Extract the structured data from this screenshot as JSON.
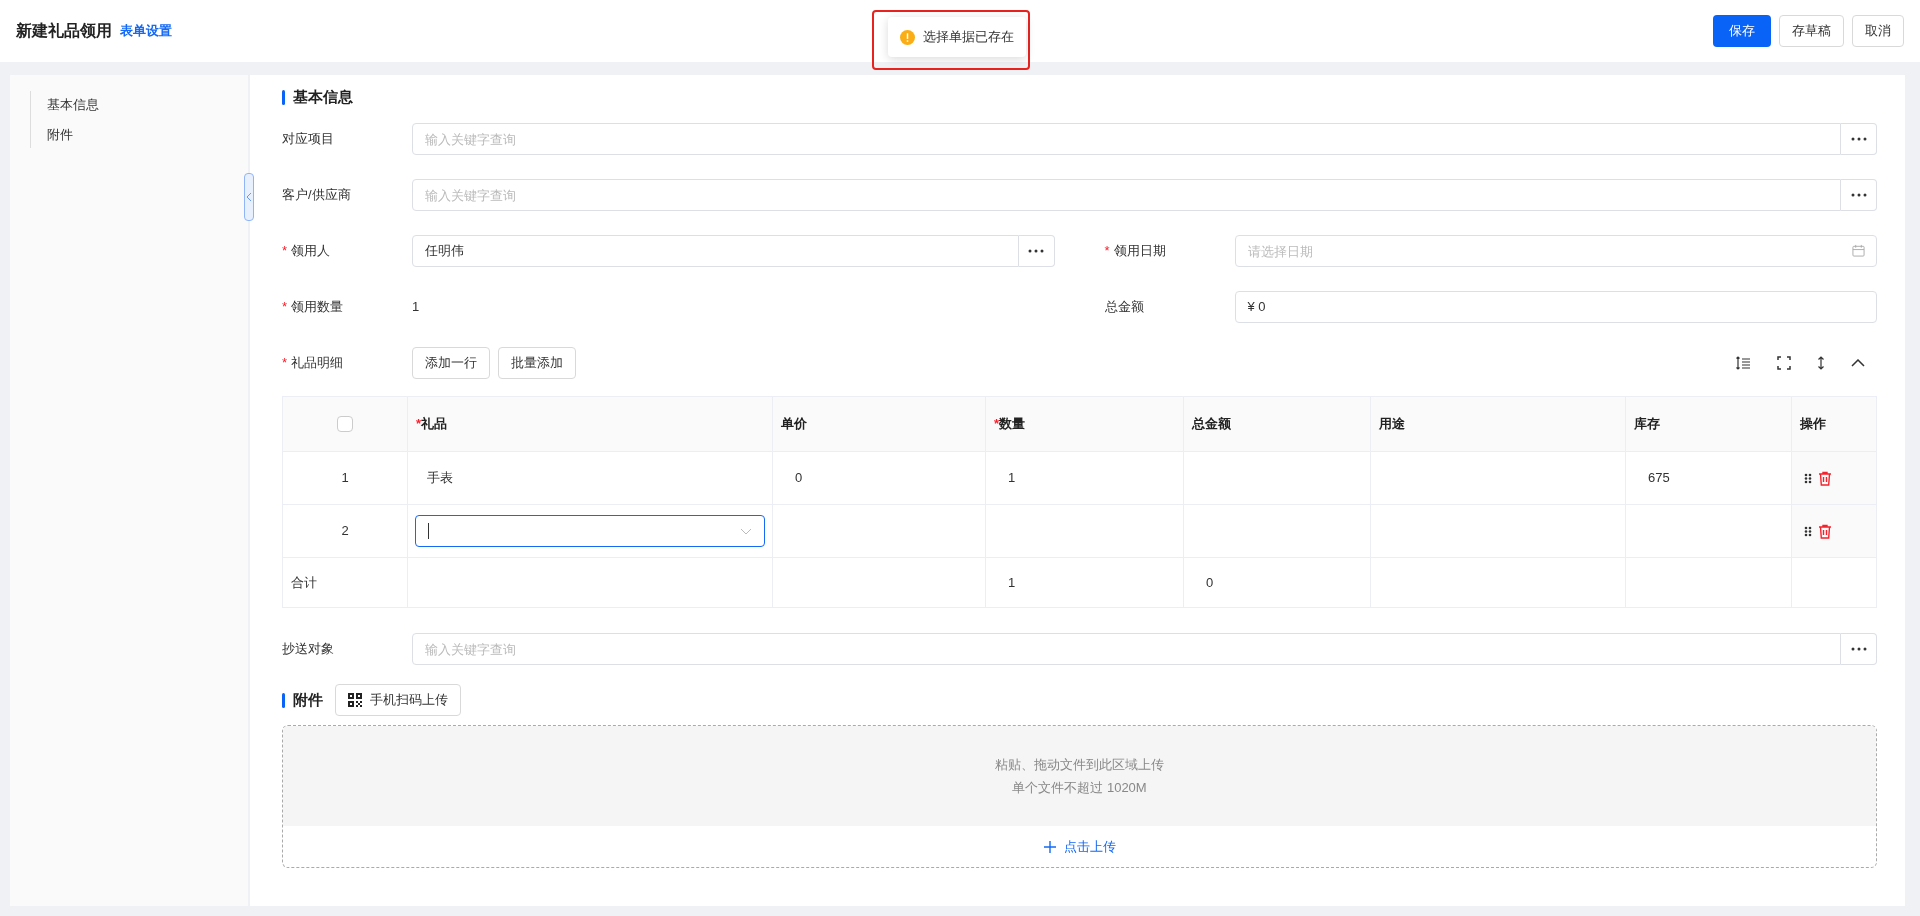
{
  "header": {
    "title": "新建礼品领用",
    "settings_link": "表单设置",
    "buttons": [
      {
        "label": "保存",
        "kind": "primary"
      },
      {
        "label": "存草稿",
        "kind": "default"
      },
      {
        "label": "取消",
        "kind": "default"
      }
    ]
  },
  "toast": {
    "message": "选择单据已存在",
    "highlighted": true
  },
  "sidebar": {
    "items": [
      {
        "label": "基本信息"
      },
      {
        "label": "附件"
      }
    ]
  },
  "basic_section": {
    "title": "基本信息"
  },
  "fields": {
    "project": {
      "label": "对应项目",
      "placeholder": "输入关键字查询"
    },
    "customer": {
      "label": "客户/供应商",
      "placeholder": "输入关键字查询"
    },
    "recipient": {
      "mark": "*",
      "label": "领用人",
      "value": "任明伟"
    },
    "date": {
      "mark": "*",
      "label": "领用日期",
      "placeholder": "请选择日期"
    },
    "quantity": {
      "mark": "*",
      "label": "领用数量",
      "value": "1"
    },
    "total": {
      "label": "总金额",
      "value": "¥ 0"
    },
    "cc": {
      "label": "抄送对象",
      "placeholder": "输入关键字查询"
    }
  },
  "details": {
    "mark": "*",
    "label": "礼品明细",
    "buttons": [
      "添加一行",
      "批量添加"
    ]
  },
  "table": {
    "columns": [
      {
        "mark": "*",
        "label": "礼品"
      },
      {
        "label": "单价"
      },
      {
        "mark": "*",
        "label": "数量"
      },
      {
        "label": "总金额"
      },
      {
        "label": "用途"
      },
      {
        "label": "库存"
      },
      {
        "label": "操作"
      }
    ],
    "header_checked": false,
    "rows": [
      {
        "index": "1",
        "gift": "手表",
        "price": "0",
        "qty": "1",
        "amount": "",
        "use": "",
        "stock": "675",
        "editing": false
      },
      {
        "index": "2",
        "gift": "",
        "price": "",
        "qty": "",
        "amount": "",
        "use": "",
        "stock": "",
        "editing": true
      }
    ],
    "summary": {
      "label": "合计",
      "qty": "1",
      "amount": "0"
    }
  },
  "attachments": {
    "title": "附件",
    "scan_button": "手机扫码上传",
    "drop_hint": "粘贴、拖动文件到此区域上传",
    "size_limit": "单个文件不超过 1020M",
    "upload_link": "点击上传"
  }
}
